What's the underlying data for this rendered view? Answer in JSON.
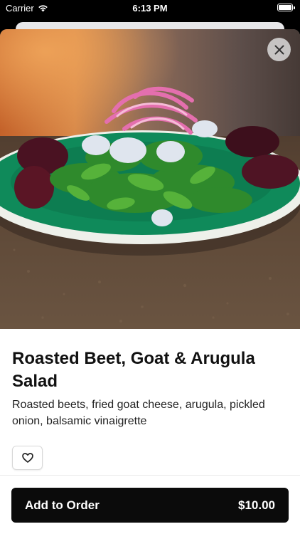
{
  "status_bar": {
    "carrier": "Carrier",
    "time": "6:13 PM",
    "wifi_icon": "wifi-icon",
    "battery_icon": "battery-icon"
  },
  "item": {
    "image_alt": "roasted-beet-salad-photo",
    "title": "Roasted Beet, Goat & Arugula Salad",
    "description": "Roasted beets, fried goat cheese, arugula, pickled onion, balsamic vinaigrette"
  },
  "actions": {
    "close_icon": "close-icon",
    "favorite_icon": "heart-outline-icon",
    "add_to_order_label": "Add to Order",
    "price": "$10.00"
  },
  "colors": {
    "button_bg": "#0b0b0b",
    "plate_green": "#0f8a5a",
    "text": "#111111"
  }
}
